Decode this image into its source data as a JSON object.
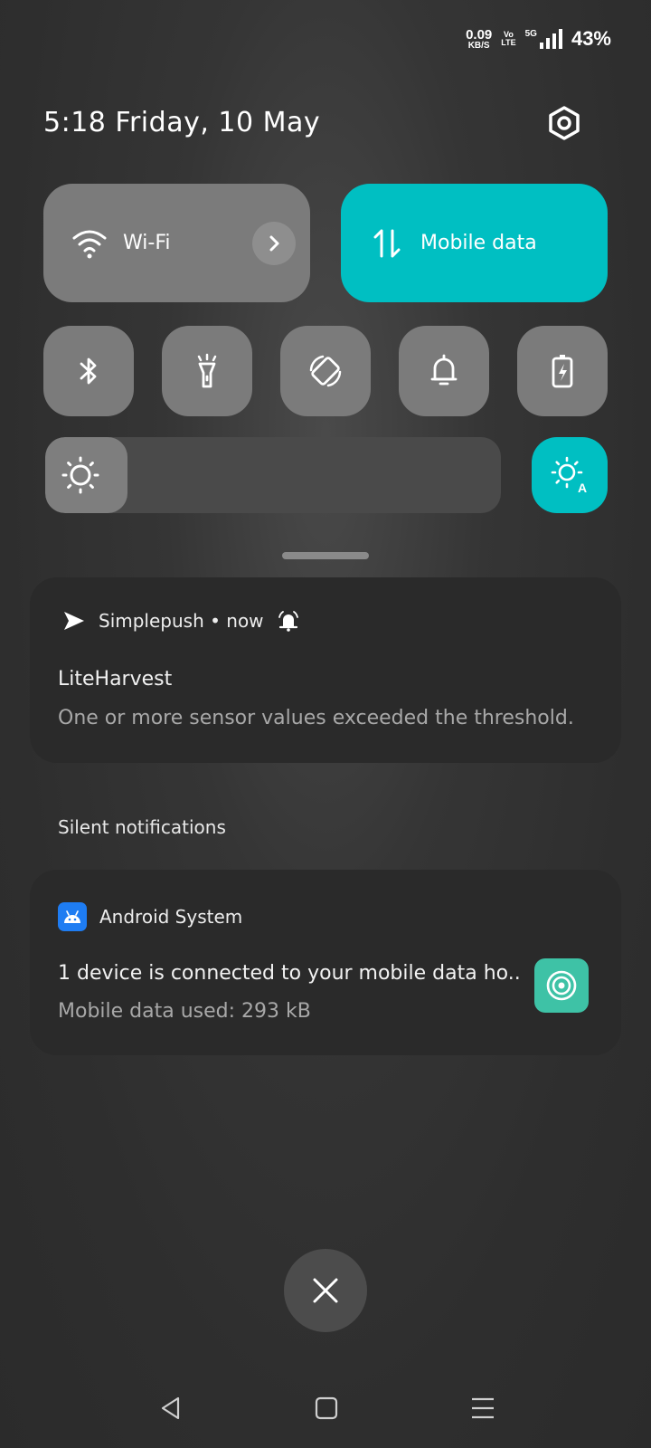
{
  "status_bar": {
    "net_speed_value": "0.09",
    "net_speed_unit": "KB/S",
    "volte_top": "Vo",
    "volte_bottom": "LTE",
    "network_type": "5G",
    "battery": "43%",
    "icons": [
      "signal-icon"
    ]
  },
  "header": {
    "datetime": "5:18  Friday, 10 May"
  },
  "quick_tiles": {
    "wifi": {
      "label": "Wi-Fi",
      "active": false
    },
    "mobile_data": {
      "label": "Mobile data",
      "active": true
    },
    "small": [
      {
        "name": "bluetooth-icon",
        "active": false
      },
      {
        "name": "flashlight-icon",
        "active": false
      },
      {
        "name": "auto-rotate-icon",
        "active": false
      },
      {
        "name": "bell-icon",
        "active": false
      },
      {
        "name": "battery-saver-icon",
        "active": false
      }
    ]
  },
  "brightness": {
    "level": 0.18,
    "auto": true
  },
  "notifications": [
    {
      "app": "Simplepush",
      "time": "now",
      "header": "Simplepush • now",
      "title": "LiteHarvest",
      "text": "One or more sensor values exceeded the threshold."
    }
  ],
  "silent_section": {
    "label": "Silent notifications",
    "items": [
      {
        "app": "Android System",
        "title": "1 device is connected to your mobile data ho..",
        "text": "Mobile data used: 293 kB"
      }
    ]
  },
  "colors": {
    "accent": "#00bfc2",
    "tile_inactive": "#7b7b7b",
    "card": "#2a2a2a",
    "hotspot": "#3ec2a6",
    "android_blue": "#1e7cf2"
  }
}
